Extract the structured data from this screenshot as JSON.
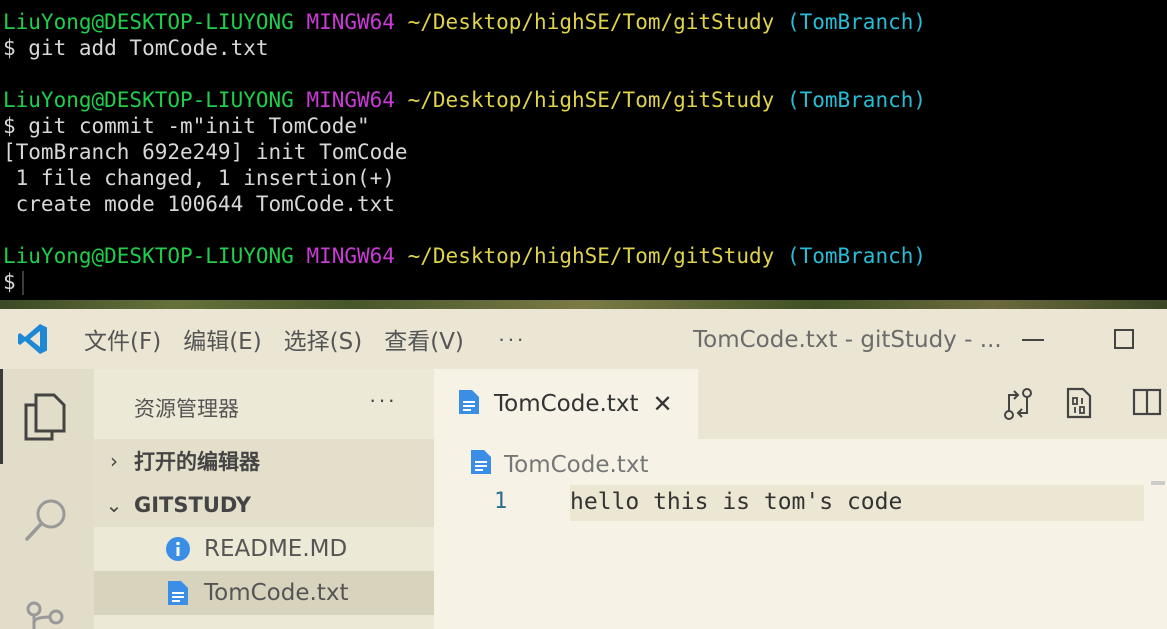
{
  "terminal": {
    "prompt_user": "LiuYong@DESKTOP-LIUYONG",
    "prompt_env": "MINGW64",
    "prompt_path": "~/Desktop/highSE/Tom/gitStudy",
    "prompt_branch": "(TomBranch)",
    "cmd1": "$ git add TomCode.txt",
    "cmd2": "$ git commit -m\"init TomCode\"",
    "out1": "[TomBranch 692e249] init TomCode",
    "out2": " 1 file changed, 1 insertion(+)",
    "out3": " create mode 100644 TomCode.txt",
    "prompt_symbol": "$"
  },
  "vscode": {
    "menu": [
      "文件(F)",
      "编辑(E)",
      "选择(S)",
      "查看(V)"
    ],
    "menu_more": "···",
    "window_title": "TomCode.txt - gitStudy - ...",
    "sidebar": {
      "title": "资源管理器",
      "more": "···",
      "open_editors": "打开的编辑器",
      "folder": "GITSTUDY",
      "files": [
        {
          "name": "README.MD",
          "icon": "info-icon"
        },
        {
          "name": "TomCode.txt",
          "icon": "file-icon"
        }
      ]
    },
    "tab": {
      "label": "TomCode.txt",
      "close": "✕"
    },
    "breadcrumb": "TomCode.txt",
    "editor": {
      "line_number": "1",
      "code": "hello this is tom's code"
    },
    "colors": {
      "vscode_blue": "#1f88d4",
      "file_icon": "#3a8ee6",
      "info_icon": "#3a8ee6"
    }
  }
}
